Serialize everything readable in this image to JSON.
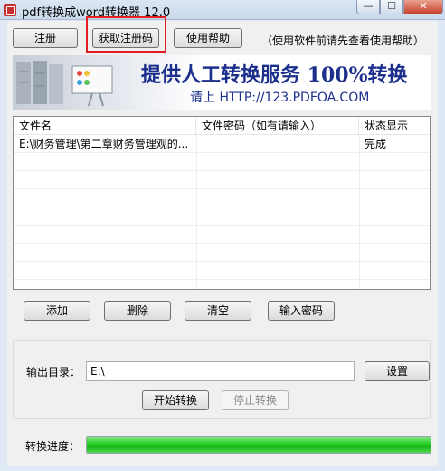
{
  "window": {
    "title": "pdf转换成word转换器 12.0",
    "min_glyph": "—",
    "max_glyph": "☐",
    "close_glyph": "✕"
  },
  "toolbar": {
    "register_label": "注册",
    "get_code_label": "获取注册码",
    "help_label": "使用帮助",
    "hint": "（使用软件前请先查看使用帮助）"
  },
  "banner": {
    "headline": "提供人工转换服务 100%转换",
    "url_line": "请上   HTTP://123.PDFOA.COM"
  },
  "table": {
    "headers": [
      "文件名",
      "文件密码（如有请输入）",
      "状态显示"
    ],
    "rows": [
      {
        "filename": "E:\\财务管理\\第二章财务管理观的...",
        "password": "",
        "status": "完成"
      }
    ]
  },
  "actions": {
    "add": "添加",
    "delete": "删除",
    "clear": "清空",
    "password": "输入密码"
  },
  "output": {
    "label": "输出目录：",
    "value": "E:\\",
    "settings": "设置",
    "start": "开始转换",
    "stop": "停止转换"
  },
  "progress": {
    "label": "转换进度：",
    "fraction": 1.0
  },
  "colors": {
    "highlight": "#e02020",
    "banner_text": "#1c2f8c",
    "progress": "#22c722"
  }
}
